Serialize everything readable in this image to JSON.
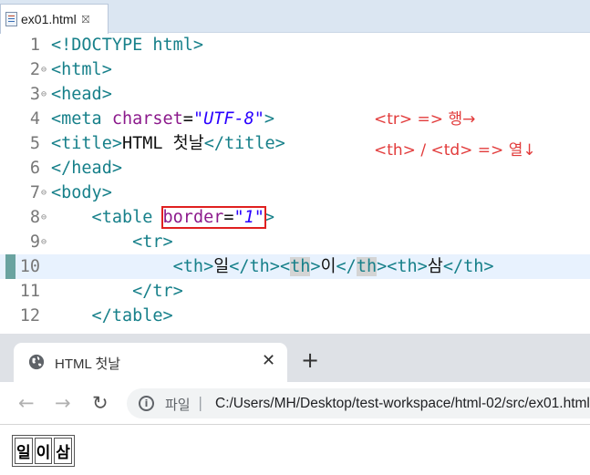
{
  "editor": {
    "tab": {
      "label": "ex01.html",
      "close": "⛝"
    },
    "lines": [
      {
        "num": "1",
        "fold": false,
        "current": false,
        "marker": false,
        "tokens": [
          {
            "t": "<!DOCTYPE html>",
            "c": "tag"
          }
        ]
      },
      {
        "num": "2",
        "fold": true,
        "current": false,
        "marker": false,
        "tokens": [
          {
            "t": "<html>",
            "c": "tag"
          }
        ]
      },
      {
        "num": "3",
        "fold": true,
        "current": false,
        "marker": false,
        "tokens": [
          {
            "t": "<head>",
            "c": "tag"
          }
        ]
      },
      {
        "num": "4",
        "fold": false,
        "current": false,
        "marker": false,
        "tokens": [
          {
            "t": "<meta ",
            "c": "tag"
          },
          {
            "t": "charset",
            "c": "attr"
          },
          {
            "t": "=",
            "c": ""
          },
          {
            "t": "\"UTF-8\"",
            "c": "val"
          },
          {
            "t": ">",
            "c": "tag"
          }
        ]
      },
      {
        "num": "5",
        "fold": false,
        "current": false,
        "marker": false,
        "tokens": [
          {
            "t": "<title>",
            "c": "tag"
          },
          {
            "t": "HTML 첫날",
            "c": ""
          },
          {
            "t": "</title>",
            "c": "tag"
          }
        ]
      },
      {
        "num": "6",
        "fold": false,
        "current": false,
        "marker": false,
        "tokens": [
          {
            "t": "</head>",
            "c": "tag"
          }
        ]
      },
      {
        "num": "7",
        "fold": true,
        "current": false,
        "marker": false,
        "tokens": [
          {
            "t": "<body>",
            "c": "tag"
          }
        ]
      },
      {
        "num": "8",
        "fold": true,
        "current": false,
        "marker": false,
        "tokens": [
          {
            "t": "    <table ",
            "c": "tag"
          },
          {
            "t": "border",
            "c": "attr",
            "box": "start"
          },
          {
            "t": "=",
            "c": "",
            "box": "mid"
          },
          {
            "t": "\"1\"",
            "c": "val",
            "box": "end"
          },
          {
            "t": ">",
            "c": "tag"
          }
        ]
      },
      {
        "num": "9",
        "fold": true,
        "current": false,
        "marker": false,
        "tokens": [
          {
            "t": "        <tr>",
            "c": "tag"
          }
        ]
      },
      {
        "num": "10",
        "fold": false,
        "current": true,
        "marker": true,
        "tokens": [
          {
            "t": "            <th>",
            "c": "tag"
          },
          {
            "t": "일",
            "c": ""
          },
          {
            "t": "</th><",
            "c": "tag"
          },
          {
            "t": "th",
            "c": "tag hl"
          },
          {
            "t": ">",
            "c": "tag"
          },
          {
            "t": "이",
            "c": ""
          },
          {
            "t": "</",
            "c": "tag"
          },
          {
            "t": "th",
            "c": "tag hl"
          },
          {
            "t": "><th>",
            "c": "tag"
          },
          {
            "t": "삼",
            "c": ""
          },
          {
            "t": "</th>",
            "c": "tag"
          }
        ]
      },
      {
        "num": "11",
        "fold": false,
        "current": false,
        "marker": false,
        "tokens": [
          {
            "t": "        </tr>",
            "c": "tag"
          }
        ]
      },
      {
        "num": "12",
        "fold": false,
        "current": false,
        "marker": false,
        "tokens": [
          {
            "t": "    </table>",
            "c": "tag"
          }
        ]
      }
    ],
    "annotations": [
      "<tr> => 행→",
      "<th> / <td> => 열↓"
    ]
  },
  "browser": {
    "tab_title": "HTML 첫날",
    "tab_close": "✕",
    "new_tab": "+",
    "nav": {
      "back": "←",
      "forward": "→",
      "reload": "↻"
    },
    "address": {
      "info_glyph": "i",
      "scheme_label": "파일",
      "separator": "|",
      "url": "C:/Users/MH/Desktop/test-workspace/html-02/src/ex01.html"
    },
    "table_cells": [
      "일",
      "이",
      "삼"
    ]
  },
  "colors": {
    "tag": "#17808a",
    "attribute": "#8c1a8c",
    "value": "#2a00ff",
    "annotation": "#e23b3b",
    "highlight_box": "#e02020"
  }
}
